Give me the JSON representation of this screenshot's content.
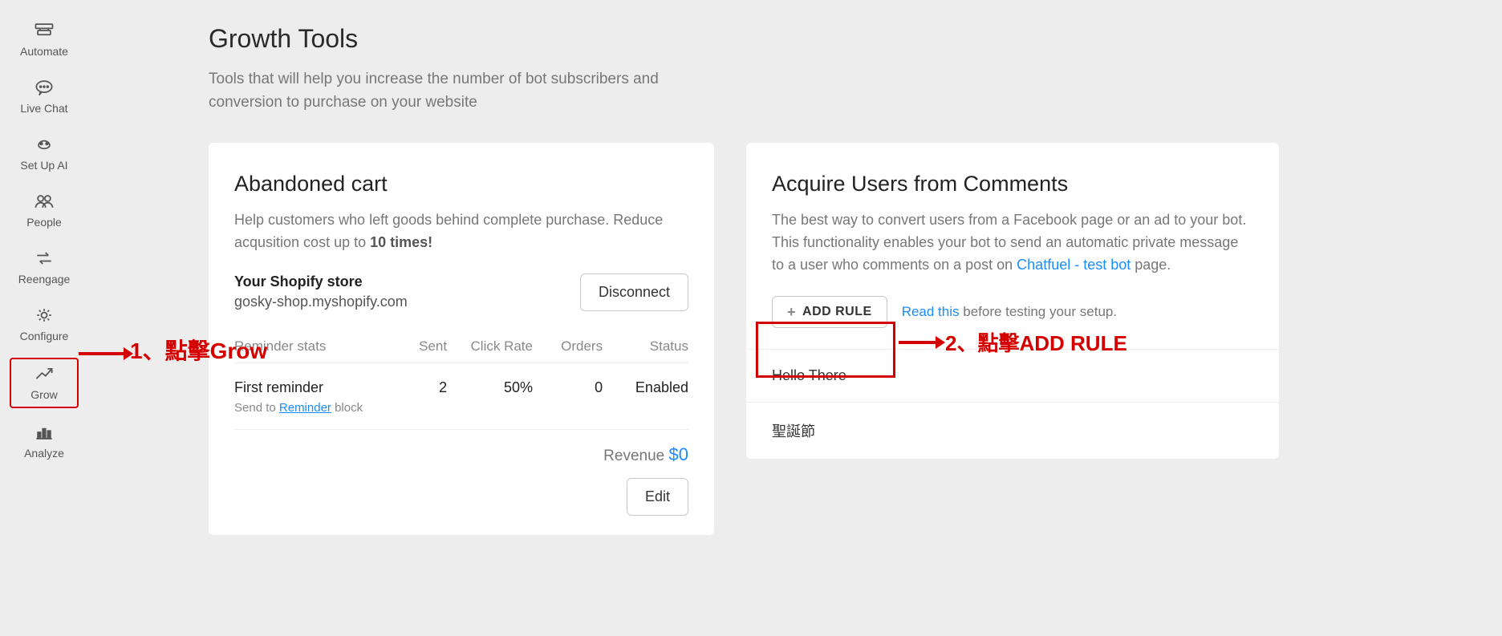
{
  "sidebar": {
    "items": [
      {
        "label": "Automate",
        "icon": "automate-icon"
      },
      {
        "label": "Live Chat",
        "icon": "chat-icon"
      },
      {
        "label": "Set Up AI",
        "icon": "ai-icon"
      },
      {
        "label": "People",
        "icon": "people-icon"
      },
      {
        "label": "Reengage",
        "icon": "reengage-icon"
      },
      {
        "label": "Configure",
        "icon": "gear-icon"
      },
      {
        "label": "Grow",
        "icon": "grow-icon",
        "active": true
      },
      {
        "label": "Analyze",
        "icon": "analyze-icon"
      }
    ]
  },
  "page": {
    "title": "Growth Tools",
    "subtitle": "Tools that will help you increase the number of bot subscribers and conversion to purchase on your website"
  },
  "abandoned": {
    "title": "Abandoned cart",
    "desc_pre": "Help customers who left goods behind complete purchase. Reduce acqusition cost up to ",
    "desc_bold": "10 times!",
    "store_label": "Your Shopify store",
    "store_url": "gosky-shop.myshopify.com",
    "disconnect_label": "Disconnect",
    "cols": {
      "name": "Reminder stats",
      "sent": "Sent",
      "click": "Click Rate",
      "orders": "Orders",
      "status": "Status"
    },
    "row": {
      "name": "First reminder",
      "sent": "2",
      "click": "50%",
      "orders": "0",
      "status": "Enabled"
    },
    "send_to_pre": "Send to ",
    "send_to_block": "Reminder",
    "send_to_post": " block",
    "revenue_label": "Revenue ",
    "revenue_amount": "$0",
    "edit_label": "Edit"
  },
  "acquire": {
    "title": "Acquire Users from Comments",
    "desc_pre": "The best way to convert users from a Facebook page or an ad to your bot. This functionality enables your bot to send an automatic private message to a user who comments on a post on ",
    "desc_link": "Chatfuel - test bot",
    "desc_post": " page.",
    "add_rule_label": "ADD RULE",
    "readthis_link": "Read this",
    "readthis_post": " before testing your setup.",
    "rules": [
      "Hello There",
      "聖誕節"
    ]
  },
  "annotations": {
    "a1": "1、點擊Grow",
    "a2": "2、點擊ADD RULE"
  }
}
